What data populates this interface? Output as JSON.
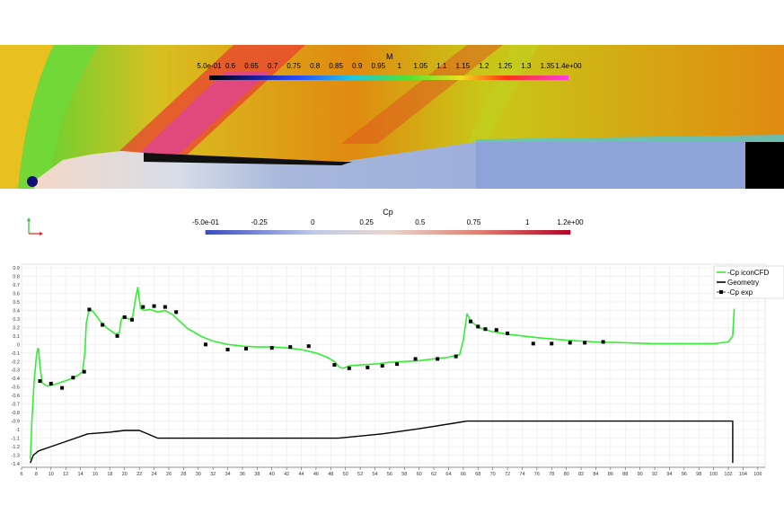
{
  "mach_field": {
    "colorbar_title": "M",
    "tick_labels": [
      "5.0e-01",
      "0.6",
      "0.65",
      "0.7",
      "0.75",
      "0.8",
      "0.85",
      "0.9",
      "0.95",
      "1",
      "1.05",
      "1.1",
      "1.15",
      "1.2",
      "1.25",
      "1.3",
      "1.35",
      "1.4e+00"
    ],
    "range": [
      0.5,
      1.4
    ]
  },
  "cp_colorbar": {
    "title": "Cp",
    "tick_labels": [
      "-5.0e-01",
      "-0.25",
      "0",
      "0.25",
      "0.5",
      "0.75",
      "1",
      "1.2e+00"
    ],
    "range": [
      -0.5,
      1.2
    ],
    "colors": {
      "low": "#3b4cc0",
      "mid": "#dddddd",
      "high": "#b40426"
    }
  },
  "orientation_axes": {
    "colors": {
      "y": "#22cc22",
      "x": "#dd2222"
    }
  },
  "chart_data": {
    "type": "line",
    "title": "",
    "xlabel": "",
    "ylabel": "",
    "xlim": [
      6,
      107
    ],
    "ylim": [
      -1.4,
      0.9
    ],
    "grid": true,
    "legend_position": "top-right",
    "x_ticks": [
      6,
      8,
      10,
      12,
      14,
      16,
      18,
      20,
      22,
      24,
      26,
      28,
      30,
      32,
      34,
      36,
      38,
      40,
      42,
      44,
      46,
      48,
      50,
      52,
      54,
      56,
      58,
      60,
      62,
      64,
      66,
      68,
      70,
      72,
      74,
      76,
      78,
      80,
      82,
      84,
      86,
      88,
      90,
      92,
      94,
      96,
      98,
      100,
      102,
      104,
      106
    ],
    "y_ticks": [
      0.9,
      0.8,
      0.7,
      0.6,
      0.5,
      0.4,
      0.3,
      0.2,
      0.1,
      0,
      -0.1,
      -0.2,
      -0.3,
      -0.4,
      -0.5,
      -0.6,
      -0.7,
      -0.8,
      -0.9,
      -1,
      -1.1,
      -1.2,
      -1.3,
      -1.4
    ],
    "y_tick_labels": [
      "0.9",
      "0.8",
      "0.7",
      "0.6",
      "0.5",
      "0.4",
      "0.3",
      "0.2",
      "0.1",
      "0",
      "-0.1",
      "-0.2",
      "-0.3",
      "-0.4",
      "-0.5",
      "-0.6",
      "-0.7",
      "-0.8",
      "-0.9",
      "-1",
      "-1.1",
      "-1.2",
      "-1.3",
      "-1.4"
    ],
    "series": [
      {
        "name": "-Cp iconCFD",
        "color": "#33ee33",
        "style": "line",
        "x": [
          7.2,
          7.4,
          7.7,
          8.0,
          8.2,
          8.3,
          8.5,
          8.8,
          9.5,
          10.5,
          11.5,
          12.5,
          13.5,
          14.3,
          14.6,
          14.8,
          15.2,
          15.8,
          16.8,
          17.8,
          18.8,
          19.3,
          19.5,
          19.8,
          20.3,
          20.8,
          21.1,
          21.5,
          21.8,
          22.0,
          22.2,
          22.6,
          23.5,
          24.5,
          25.5,
          26.5,
          27.5,
          28.5,
          29.5,
          30.5,
          32,
          34,
          36,
          38,
          40,
          42,
          44,
          46,
          47.5,
          48.5,
          49.2,
          49.7,
          50.5,
          52,
          54,
          56,
          58,
          60,
          62,
          64,
          65.5,
          66,
          66.5,
          67,
          68,
          70,
          72,
          76,
          80,
          84,
          88,
          92,
          96,
          100,
          102,
          102.6,
          102.8
        ],
        "y": [
          -1.35,
          -0.9,
          -0.45,
          -0.15,
          -0.05,
          -0.05,
          -0.25,
          -0.45,
          -0.49,
          -0.47,
          -0.44,
          -0.41,
          -0.37,
          -0.32,
          -0.1,
          0.25,
          0.42,
          0.38,
          0.26,
          0.18,
          0.12,
          0.14,
          0.28,
          0.33,
          0.31,
          0.29,
          0.33,
          0.55,
          0.67,
          0.52,
          0.42,
          0.4,
          0.41,
          0.38,
          0.4,
          0.35,
          0.27,
          0.19,
          0.14,
          0.09,
          0.04,
          0.0,
          -0.02,
          -0.03,
          -0.03,
          -0.04,
          -0.06,
          -0.1,
          -0.15,
          -0.2,
          -0.27,
          -0.28,
          -0.25,
          -0.24,
          -0.23,
          -0.21,
          -0.2,
          -0.19,
          -0.17,
          -0.15,
          -0.12,
          0.05,
          0.36,
          0.28,
          0.2,
          0.15,
          0.12,
          0.08,
          0.05,
          0.03,
          0.02,
          0.01,
          0.01,
          0.01,
          0.03,
          0.1,
          0.42
        ]
      },
      {
        "name": "Geometry",
        "color": "#000000",
        "style": "line",
        "x": [
          7.2,
          7.6,
          8.3,
          10,
          12,
          15,
          18,
          20,
          22,
          24.5,
          30,
          40,
          49,
          55,
          60,
          66.5,
          70,
          80,
          90,
          100,
          102.6,
          102.6
        ],
        "y": [
          -1.39,
          -1.3,
          -1.25,
          -1.2,
          -1.14,
          -1.05,
          -1.03,
          -1.01,
          -1.01,
          -1.1,
          -1.1,
          -1.1,
          -1.1,
          -1.05,
          -0.99,
          -0.9,
          -0.9,
          -0.9,
          -0.9,
          -0.9,
          -0.9,
          -1.39
        ]
      },
      {
        "name": "-Cp exp",
        "color": "#000000",
        "style": "markers",
        "x": [
          8.5,
          10,
          11.5,
          13,
          14.5,
          15.2,
          17,
          19,
          20,
          21,
          22.5,
          24,
          25.5,
          27,
          31,
          34,
          36.5,
          40,
          42.5,
          45,
          48.5,
          50.5,
          53,
          55,
          57,
          59.5,
          62.5,
          65,
          67,
          68,
          69,
          70.5,
          72,
          75.5,
          78,
          80.5,
          82.5,
          85
        ],
        "y": [
          -0.43,
          -0.46,
          -0.51,
          -0.39,
          -0.32,
          0.41,
          0.23,
          0.1,
          0.32,
          0.29,
          0.44,
          0.45,
          0.44,
          0.38,
          0.0,
          -0.06,
          -0.05,
          -0.04,
          -0.03,
          -0.02,
          -0.24,
          -0.28,
          -0.27,
          -0.25,
          -0.23,
          -0.17,
          -0.17,
          -0.14,
          0.27,
          0.21,
          0.18,
          0.17,
          0.13,
          0.01,
          0.01,
          0.02,
          0.02,
          0.03
        ]
      }
    ]
  }
}
